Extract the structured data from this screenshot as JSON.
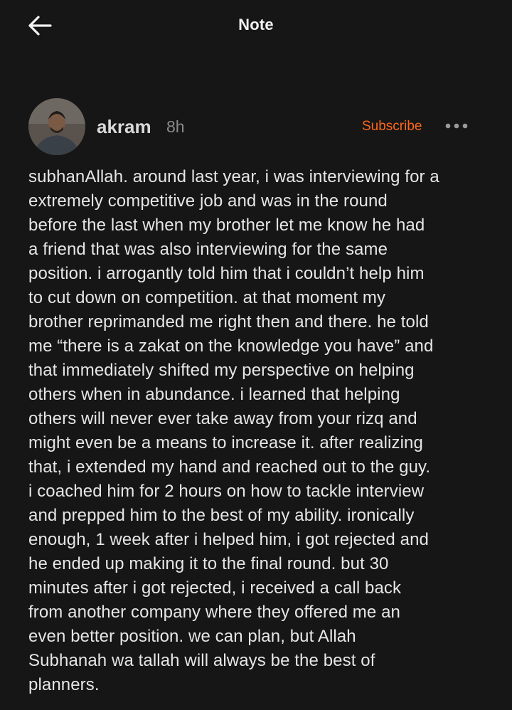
{
  "header": {
    "title": "Note"
  },
  "author": {
    "name": "akram",
    "time": "8h",
    "subscribe_label": "Subscribe"
  },
  "colors": {
    "background": "#161616",
    "accent": "#ff6719",
    "text": "#e6e6e6",
    "muted": "#8a8a8a"
  },
  "icons": {
    "back": "arrow-left-icon",
    "more": "more-horizontal-icon"
  },
  "note": {
    "lines": [
      "subhanAllah. around last year, i was interviewing for a",
      "extremely competitive job and was in the round",
      "before the last when my brother let me know he had",
      "a friend that was also interviewing for the same",
      "position. i arrogantly told him that i couldn’t help him",
      "to cut down on competition. at that moment my",
      "brother reprimanded me right then and there. he told",
      "me “there is a zakat on the knowledge you have” and",
      "that immediately shifted my perspective on helping",
      "others when in abundance. i learned that helping",
      "others will never ever take away from your rizq and",
      "might even be a means to increase it. after realizing",
      "that, i extended my hand and reached out to the guy.",
      "i coached him for 2 hours on how to tackle interview",
      "and prepped him to the best of my ability. ironically",
      "enough, 1 week after i helped him, i got rejected and",
      "he ended up making it to the final round. but 30",
      "minutes after i got rejected, i received a call back",
      "from another company where they offered me an",
      "even better position. we can plan, but Allah",
      "Subhanah wa tallah will always be the best of",
      "planners."
    ]
  }
}
